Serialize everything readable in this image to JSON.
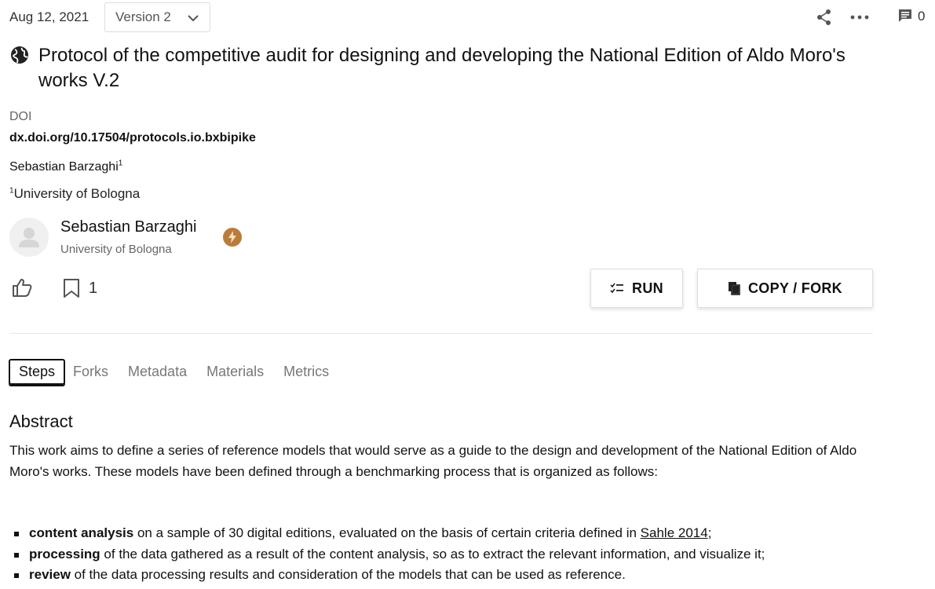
{
  "header": {
    "date": "Aug 12, 2021",
    "version_label": "Version 2",
    "comment_count": "0"
  },
  "protocol": {
    "title": "Protocol of the competitive audit for designing and developing the National Edition of Aldo Moro's works V.2",
    "doi_label": "DOI",
    "doi_value": "dx.doi.org/10.17504/protocols.io.bxbipike",
    "authors_line": "Sebastian Barzaghi",
    "author_sup": "1",
    "affiliation_sup": "1",
    "affiliation_line": "University of Bologna"
  },
  "author_card": {
    "name": "Sebastian Barzaghi",
    "affiliation": "University of Bologna",
    "badge_color": "#b97c3a"
  },
  "actions": {
    "bookmark_count": "1",
    "run_label": "RUN",
    "fork_label": "COPY / FORK"
  },
  "tabs": [
    {
      "label": "Steps",
      "active": true
    },
    {
      "label": "Forks",
      "active": false
    },
    {
      "label": "Metadata",
      "active": false
    },
    {
      "label": "Materials",
      "active": false
    },
    {
      "label": "Metrics",
      "active": false
    }
  ],
  "abstract": {
    "heading": "Abstract",
    "text": "This work aims to define a series of reference models that would serve as a guide to the design and development of the National Edition of Aldo Moro's works. These models have been defined through a benchmarking process that is organized as follows:",
    "bullets": [
      {
        "bold": "content analysis",
        "text": " on a sample of 30 digital editions, evaluated on the basis of certain criteria defined in ",
        "link": "Sahle 2014",
        "after": ";"
      },
      {
        "bold": "processing",
        "text": " of the data gathered as a result of the content analysis, so as to extract the relevant information, and visualize it;"
      },
      {
        "bold": "review",
        "text": " of the data processing results and consideration of the models that can be used as reference."
      }
    ]
  }
}
